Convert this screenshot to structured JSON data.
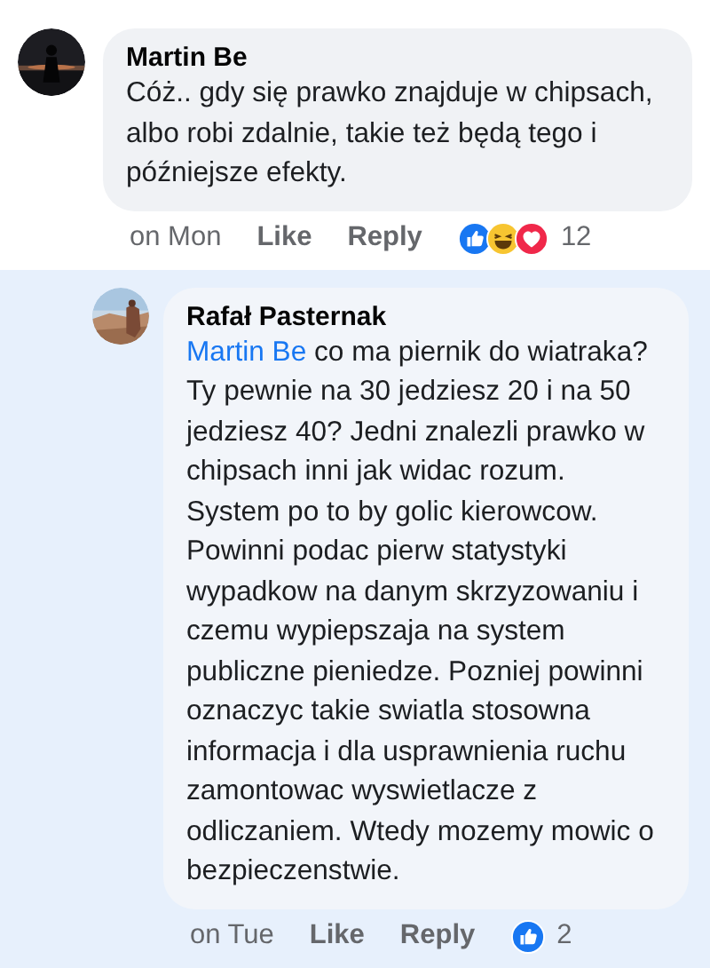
{
  "comments": [
    {
      "author": "Martin Be",
      "text": "Cóż.. gdy się prawko znajduje w chipsach, albo robi zdalnie, takie też będą tego i późniejsze efekty.",
      "highlighted": false,
      "reply": false,
      "time": "on Mon",
      "like": "Like",
      "reply_label": "Reply",
      "reactions": [
        {
          "kind": "like"
        },
        {
          "kind": "haha"
        },
        {
          "kind": "love"
        }
      ],
      "reaction_count": "12"
    },
    {
      "author": "Rafał Pasternak",
      "mention": "Martin Be",
      "text": "co ma piernik do wiatraka? Ty pewnie na 30 jedziesz 20 i na 50 jedziesz 40? Jedni znalezli prawko w chipsach inni jak widac rozum. System po to by golic kierowcow. Powinni podac pierw statystyki wypadkow na danym skrzyzowaniu i czemu wypiepszaja na system publiczne pieniedze. Pozniej powinni oznaczyc takie swiatla stosowna informacja i dla usprawnienia ruchu zamontowac wyswietlacze z odliczaniem. Wtedy mozemy mowic o bezpieczenstwie.",
      "highlighted": true,
      "reply": true,
      "time": "on Tue",
      "like": "Like",
      "reply_label": "Reply",
      "reactions": [
        {
          "kind": "like"
        }
      ],
      "reaction_count": "2"
    }
  ]
}
